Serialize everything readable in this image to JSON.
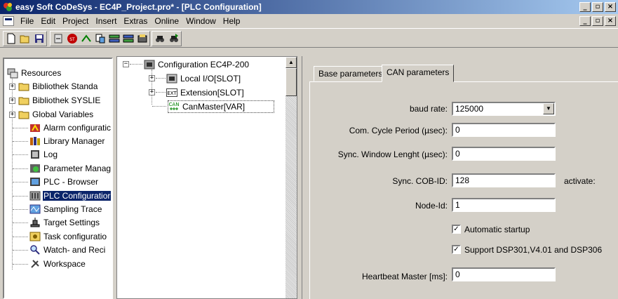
{
  "window": {
    "title": "easy Soft CoDeSys - EC4P_Project.pro* - [PLC Configuration]",
    "min": "_",
    "restore": "▫",
    "close": "×"
  },
  "menu": {
    "items": [
      "File",
      "Edit",
      "Project",
      "Insert",
      "Extras",
      "Online",
      "Window",
      "Help"
    ]
  },
  "left_tree": {
    "items": [
      {
        "label": "Resources",
        "icon": "resources-icon"
      },
      {
        "label": "Bibliothek Standa",
        "icon": "folder-icon",
        "expander": "+"
      },
      {
        "label": "Bibliothek SYSLIE",
        "icon": "folder-icon",
        "expander": "+"
      },
      {
        "label": "Global Variables",
        "icon": "folder-icon",
        "expander": "+"
      },
      {
        "label": "Alarm configuratic",
        "icon": "alarm-icon"
      },
      {
        "label": "Library Manager",
        "icon": "library-icon"
      },
      {
        "label": "Log",
        "icon": "log-icon"
      },
      {
        "label": "Parameter Manag",
        "icon": "parameter-icon"
      },
      {
        "label": "PLC - Browser",
        "icon": "browser-icon"
      },
      {
        "label": "PLC Configuratior",
        "icon": "plc-config-icon",
        "selected": true
      },
      {
        "label": "Sampling Trace",
        "icon": "trace-icon"
      },
      {
        "label": "Target Settings",
        "icon": "target-icon"
      },
      {
        "label": "Task configuratio",
        "icon": "task-icon"
      },
      {
        "label": "Watch- and Reci",
        "icon": "watch-icon"
      },
      {
        "label": "Workspace",
        "icon": "workspace-icon"
      }
    ]
  },
  "mid_tree": {
    "root": "Configuration EC4P-200",
    "items": [
      {
        "label": "Local I/O[SLOT]",
        "icon": "io-module-icon",
        "expander": "+"
      },
      {
        "label": "Extension[SLOT]",
        "icon": "ext-module-icon",
        "expander": "+",
        "icon_text": "EXT"
      },
      {
        "label": "CanMaster[VAR]",
        "icon": "can-icon",
        "icon_text": "CAN"
      }
    ],
    "root_expander": "−"
  },
  "tabs": [
    {
      "label": "Base parameters",
      "active": false
    },
    {
      "label": "CAN parameters",
      "active": true
    }
  ],
  "can_params": {
    "baud_rate_label": "baud rate:",
    "baud_rate_value": "125000",
    "com_cycle_label": "Com. Cycle Period (µsec):",
    "com_cycle_value": "0",
    "sync_window_label": "Sync. Window Lenght (µsec):",
    "sync_window_value": "0",
    "sync_cob_label": "Sync. COB-ID:",
    "sync_cob_value": "128",
    "activate_label": "activate:",
    "node_id_label": "Node-Id:",
    "node_id_value": "1",
    "auto_startup_label": "Automatic startup",
    "auto_startup_checked": true,
    "support_dsp_label": "Support DSP301,V4.01 and DSP306",
    "support_dsp_checked": true,
    "heartbeat_label": "Heartbeat Master [ms]:",
    "heartbeat_value": "0",
    "check_mark": "✓"
  },
  "colors": {
    "titlebar_start": "#0a246a",
    "titlebar_end": "#a6caf0",
    "selection": "#0a246a",
    "face": "#d4d0c8"
  }
}
